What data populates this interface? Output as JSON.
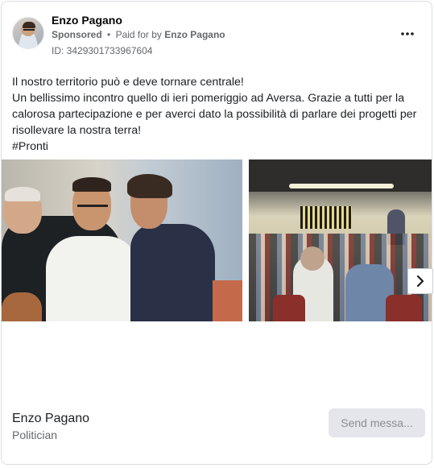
{
  "post": {
    "author": "Enzo Pagano",
    "sponsored_label": "Sponsored",
    "separator": "•",
    "paid_for_prefix": "Paid for by",
    "payer": "Enzo Pagano",
    "ad_id": "ID: 3429301733967604",
    "more_icon": "more-horizontal-icon",
    "text_lines": [
      "Il nostro territorio può e deve tornare centrale!",
      "Un bellissimo incontro quello di ieri pomeriggio ad Aversa. Grazie a tutti per la",
      "calorosa partecipazione e per averci dato la possibilità di parlare dei progetti per",
      "risollevare la nostra terra!",
      "#Pronti"
    ]
  },
  "carousel": {
    "next_icon": "chevron-right-icon",
    "images": [
      "meeting-conversation-photo",
      "audience-hall-photo"
    ]
  },
  "footer": {
    "page_name": "Enzo Pagano",
    "category": "Politician",
    "cta_label": "Send messa..."
  },
  "colors": {
    "text": "#1c1e21",
    "secondary": "#65676b",
    "button_bg": "#e4e6eb",
    "button_text": "#8a8d91",
    "border": "#dadde1"
  }
}
